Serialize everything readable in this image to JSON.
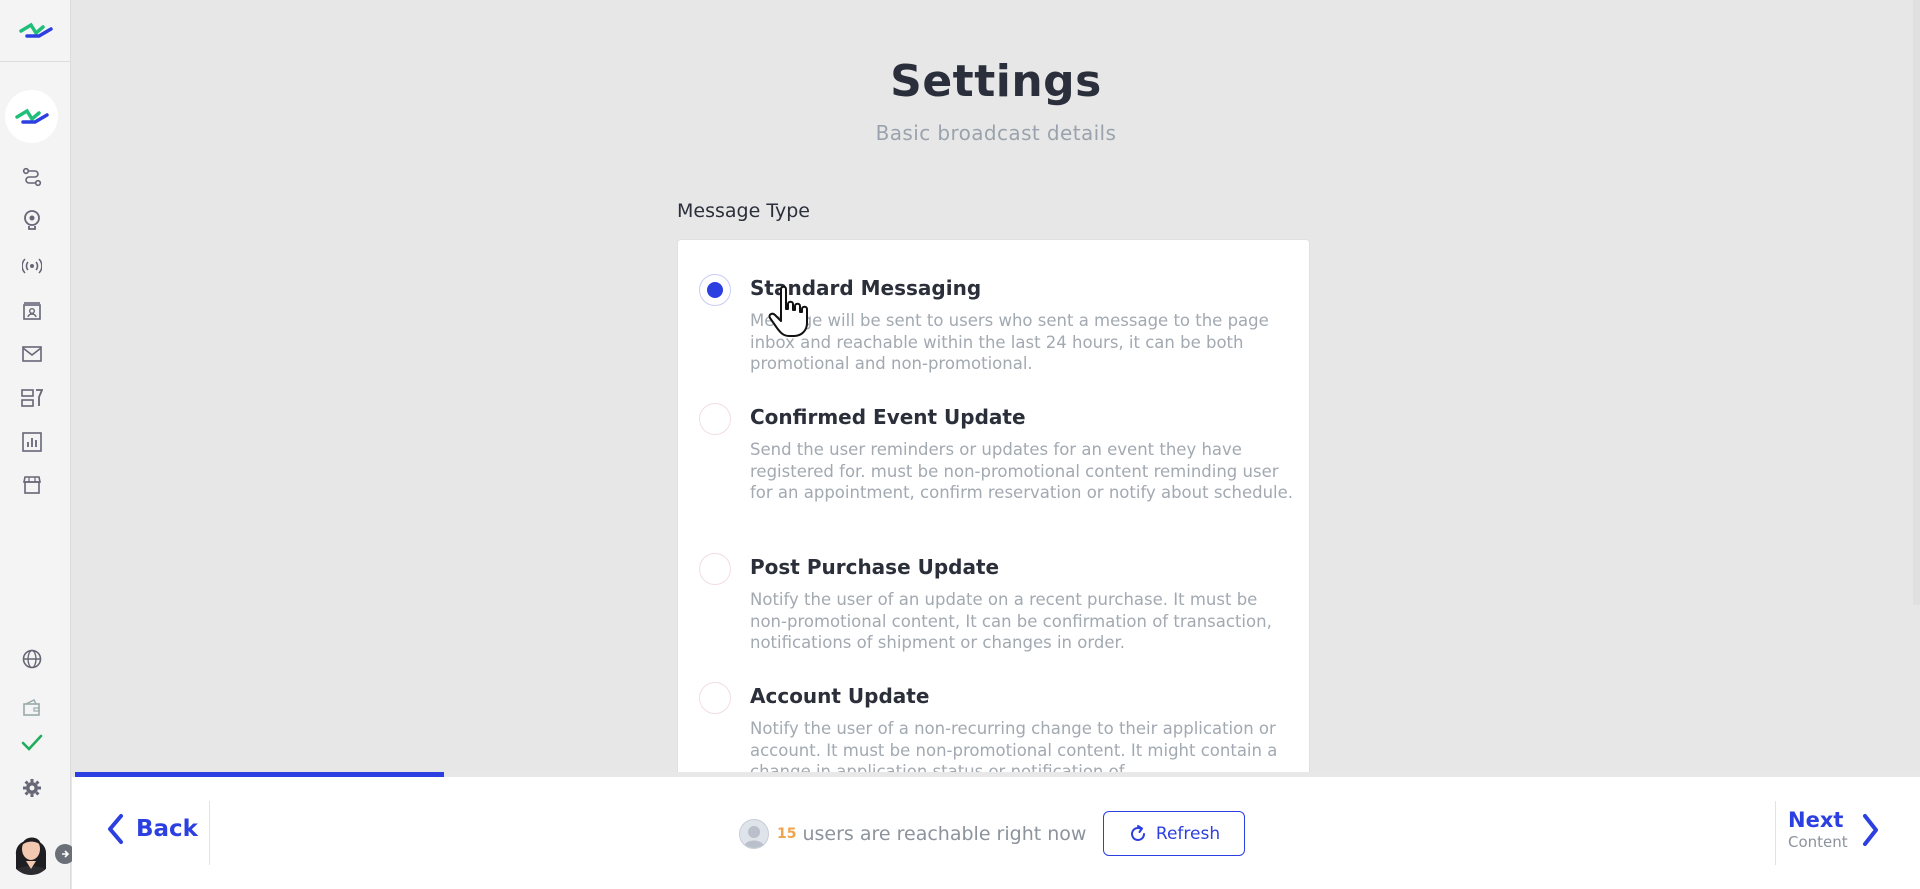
{
  "sidebar": {
    "icons": [
      "flow-icon",
      "bulb-icon",
      "broadcast-icon",
      "contacts-icon",
      "mail-icon",
      "templates-icon",
      "analytics-icon",
      "store-icon",
      "globe-icon",
      "wallet-icon",
      "check-icon",
      "gear-icon"
    ]
  },
  "header": {
    "title": "Settings",
    "subtitle": "Basic broadcast details"
  },
  "message_type": {
    "label": "Message Type",
    "selected": "Standard Messaging",
    "options": [
      {
        "title": "Standard Messaging",
        "description": "Message will be sent to users who sent a message to the page inbox and reachable within the last 24 hours, it can be both promotional and non-promotional."
      },
      {
        "title": "Confirmed Event Update",
        "description": "Send the user reminders or updates for an event they have registered for. must be non-promotional content reminding user for an appointment, confirm reservation or notify about schedule."
      },
      {
        "title": "Post Purchase Update",
        "description": "Notify the user of an update on a recent purchase. It must be non-promotional content, It can be confirmation of transaction, notifications of shipment or changes in order."
      },
      {
        "title": "Account Update",
        "description": "Notify the user of a non-recurring change to their application or account. It must be non-promotional content. It might contain a change in application status or notification of"
      }
    ]
  },
  "progress": {
    "fraction": 0.2
  },
  "footer": {
    "back_label": "Back",
    "reach_count": "15",
    "reach_text": "users are reachable right now",
    "refresh_label": "Refresh",
    "next_label": "Next",
    "next_sub": "Content"
  },
  "colors": {
    "accent": "#2c3fe0",
    "brand_green": "#1fbf7a",
    "brand_blue": "#2c3fe0"
  }
}
